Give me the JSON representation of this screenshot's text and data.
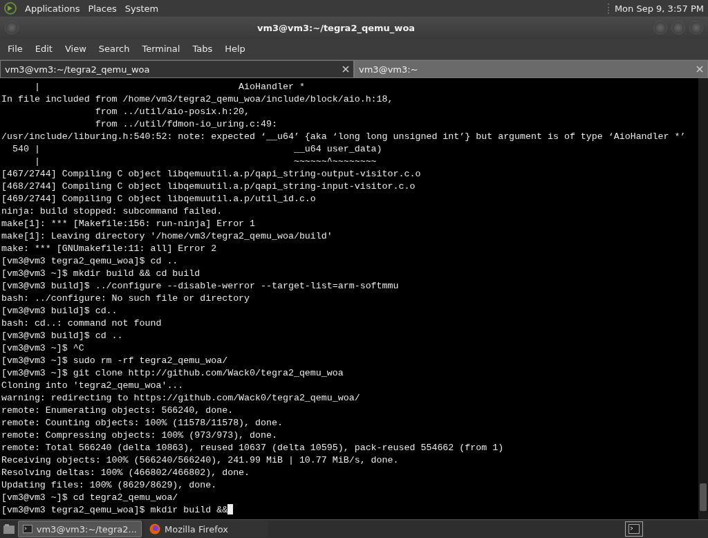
{
  "top_panel": {
    "menus": [
      "Applications",
      "Places",
      "System"
    ],
    "clock": "Mon Sep  9,  3:57 PM"
  },
  "window": {
    "title": "vm3@vm3:~/tegra2_qemu_woa"
  },
  "menu_bar": [
    "File",
    "Edit",
    "View",
    "Search",
    "Terminal",
    "Tabs",
    "Help"
  ],
  "tabs": [
    {
      "label": "vm3@vm3:~/tegra2_qemu_woa",
      "selected": true
    },
    {
      "label": "vm3@vm3:~",
      "selected": false
    }
  ],
  "terminal": {
    "lines": [
      "      |                                    AioHandler *",
      "In file included from /home/vm3/tegra2_qemu_woa/include/block/aio.h:18,",
      "                 from ../util/aio-posix.h:20,",
      "                 from ../util/fdmon-io_uring.c:49:",
      "/usr/include/liburing.h:540:52: note: expected ‘__u64’ {aka ‘long long unsigned int’} but argument is of type ‘AioHandler *’",
      "  540 |                                              __u64 user_data)",
      "      |                                              ~~~~~~^~~~~~~~~",
      "[467/2744] Compiling C object libqemuutil.a.p/qapi_string-output-visitor.c.o",
      "[468/2744] Compiling C object libqemuutil.a.p/qapi_string-input-visitor.c.o",
      "[469/2744] Compiling C object libqemuutil.a.p/util_id.c.o",
      "ninja: build stopped: subcommand failed.",
      "make[1]: *** [Makefile:156: run-ninja] Error 1",
      "make[1]: Leaving directory '/home/vm3/tegra2_qemu_woa/build'",
      "make: *** [GNUmakefile:11: all] Error 2",
      "[vm3@vm3 tegra2_qemu_woa]$ cd ..",
      "[vm3@vm3 ~]$ mkdir build && cd build",
      "[vm3@vm3 build]$ ../configure --disable-werror --target-list=arm-softmmu",
      "bash: ../configure: No such file or directory",
      "[vm3@vm3 build]$ cd..",
      "bash: cd..: command not found",
      "[vm3@vm3 build]$ cd ..",
      "[vm3@vm3 ~]$ ^C",
      "[vm3@vm3 ~]$ sudo rm -rf tegra2_qemu_woa/",
      "[vm3@vm3 ~]$ git clone http://github.com/Wack0/tegra2_qemu_woa",
      "Cloning into 'tegra2_qemu_woa'...",
      "warning: redirecting to https://github.com/Wack0/tegra2_qemu_woa/",
      "remote: Enumerating objects: 566240, done.",
      "remote: Counting objects: 100% (11578/11578), done.",
      "remote: Compressing objects: 100% (973/973), done.",
      "remote: Total 566240 (delta 10863), reused 10637 (delta 10595), pack-reused 554662 (from 1)",
      "Receiving objects: 100% (566240/566240), 241.99 MiB | 10.77 MiB/s, done.",
      "Resolving deltas: 100% (466802/466802), done.",
      "Updating files: 100% (8629/8629), done.",
      "[vm3@vm3 ~]$ cd tegra2_qemu_woa/",
      "[vm3@vm3 tegra2_qemu_woa]$ mkdir build &&"
    ]
  },
  "taskbar": {
    "items": [
      {
        "label": "vm3@vm3:~/tegra2...",
        "selected": true,
        "kind": "terminal"
      },
      {
        "label": "Mozilla Firefox",
        "selected": false,
        "kind": "browser"
      }
    ]
  }
}
